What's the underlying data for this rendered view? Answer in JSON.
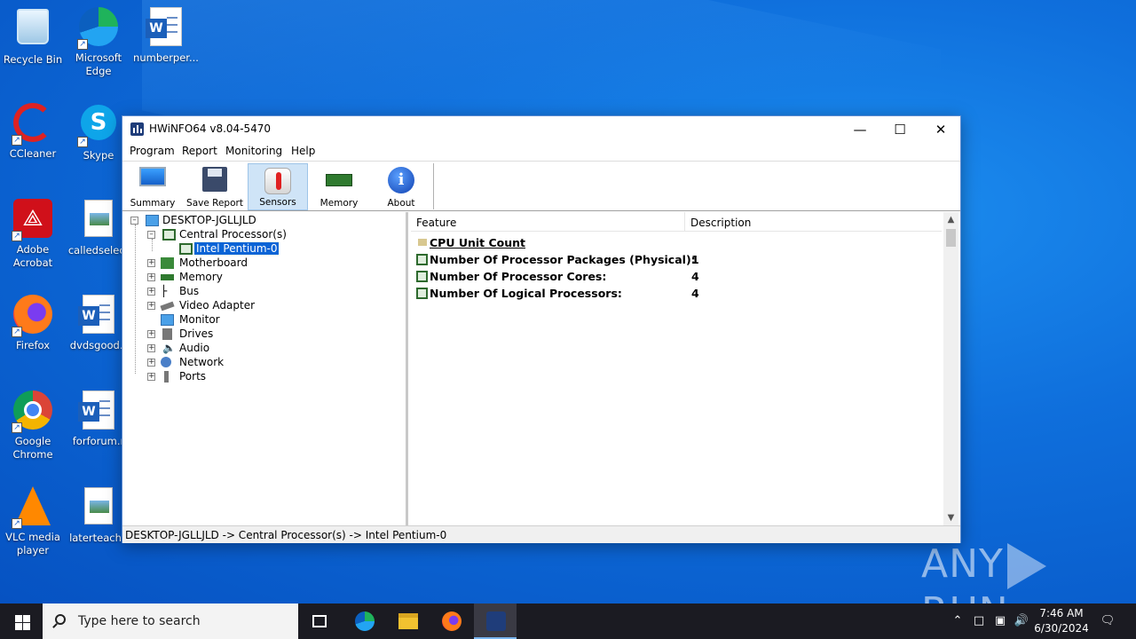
{
  "desktop": {
    "icons": [
      {
        "label": "Recycle Bin"
      },
      {
        "label": "Microsoft Edge"
      },
      {
        "label": "numberper..."
      },
      {
        "label": "CCleaner"
      },
      {
        "label": "Skype"
      },
      {
        "label": "Adobe Acrobat"
      },
      {
        "label": "calledselect"
      },
      {
        "label": "Firefox"
      },
      {
        "label": "dvdsgood.r"
      },
      {
        "label": "Google Chrome"
      },
      {
        "label": "forforum.r"
      },
      {
        "label": "VLC media player"
      },
      {
        "label": "laterteache"
      }
    ]
  },
  "window": {
    "title": "HWiNFO64 v8.04-5470",
    "menu": [
      "Program",
      "Report",
      "Monitoring",
      "Help"
    ],
    "toolbar": [
      {
        "label": "Summary",
        "icon": "monitor-icon"
      },
      {
        "label": "Save Report",
        "icon": "floppy-icon"
      },
      {
        "label": "Sensors",
        "icon": "thermometer-icon",
        "active": true
      },
      {
        "label": "Memory",
        "icon": "ram-icon"
      },
      {
        "label": "About",
        "icon": "info-icon"
      }
    ],
    "tree": {
      "root": "DESKTOP-JGLLJLD",
      "items": [
        {
          "label": "Central Processor(s)"
        },
        {
          "label": "Intel Pentium-0",
          "selected": true
        },
        {
          "label": "Motherboard"
        },
        {
          "label": "Memory"
        },
        {
          "label": "Bus"
        },
        {
          "label": "Video Adapter"
        },
        {
          "label": "Monitor"
        },
        {
          "label": "Drives"
        },
        {
          "label": "Audio"
        },
        {
          "label": "Network"
        },
        {
          "label": "Ports"
        }
      ]
    },
    "details": {
      "columns": [
        "Feature",
        "Description"
      ],
      "rows": [
        {
          "feature": "CPU Unit Count",
          "value": ""
        },
        {
          "feature": "Number Of Processor Packages (Physical):",
          "value": "1"
        },
        {
          "feature": "Number Of Processor Cores:",
          "value": "4"
        },
        {
          "feature": "Number Of Logical Processors:",
          "value": "4"
        }
      ]
    },
    "status": "DESKTOP-JGLLJLD -> Central Processor(s) -> Intel Pentium-0"
  },
  "watermark": {
    "left": "ANY",
    "right": "RUN"
  },
  "taskbar": {
    "search_placeholder": "Type here to search",
    "time": "7:46 AM",
    "date": "6/30/2024"
  },
  "colors": {
    "accent": "#0a64d6",
    "taskbar": "#1b1b22",
    "desktop": "#0f6fdc"
  }
}
